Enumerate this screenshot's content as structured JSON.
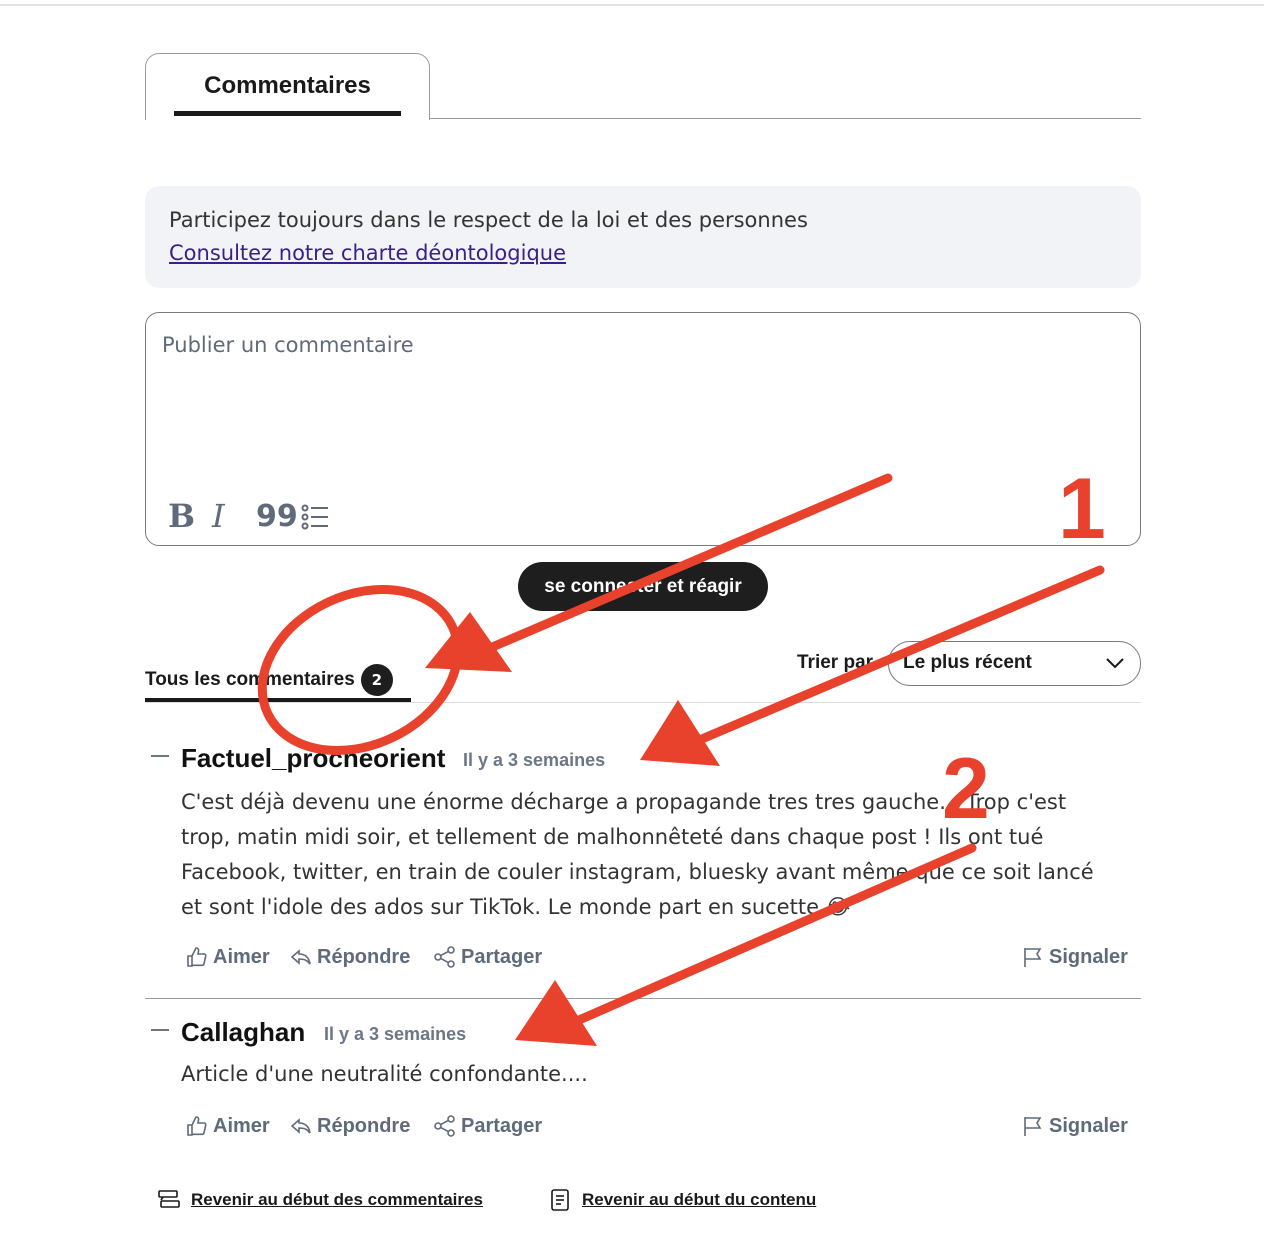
{
  "tab": {
    "label": "Commentaires"
  },
  "banner": {
    "text": "Participez toujours dans le respect de la loi et des personnes",
    "link": "Consultez notre charte déontologique"
  },
  "editor": {
    "placeholder": "Publier un commentaire",
    "tools": {
      "bold": "B",
      "italic": "I",
      "quote": "99"
    }
  },
  "connect_button": "se connecter et réagir",
  "comments_tabs": {
    "all_label": "Tous les commentaires",
    "count": "2"
  },
  "sort": {
    "label": "Trier par",
    "value": "Le plus récent"
  },
  "comments": [
    {
      "author": "Factuel_procheorient",
      "time": "Il y a 3 semaines",
      "body": "C'est déjà devenu une énorme décharge a propagande tres tres gauche... Trop c'est trop, matin midi soir, et tellement de malhonnêteté dans chaque post ! Ils ont tué Facebook, twitter, en train de couler instagram, bluesky avant même que ce soit lancé et sont l'idole des ados sur TikTok. Le monde part en sucette 😂",
      "actions": {
        "like": "Aimer",
        "reply": "Répondre",
        "share": "Partager",
        "report": "Signaler"
      }
    },
    {
      "author": "Callaghan",
      "time": "Il y a 3 semaines",
      "body": "Article d'une neutralité confondante....",
      "actions": {
        "like": "Aimer",
        "reply": "Répondre",
        "share": "Partager",
        "report": "Signaler"
      }
    }
  ],
  "footer": {
    "back_comments": "Revenir au début des commentaires",
    "back_content": "Revenir au début du contenu"
  },
  "annotations": {
    "label_1": "1",
    "label_2": "2",
    "color": "#e8412c"
  }
}
